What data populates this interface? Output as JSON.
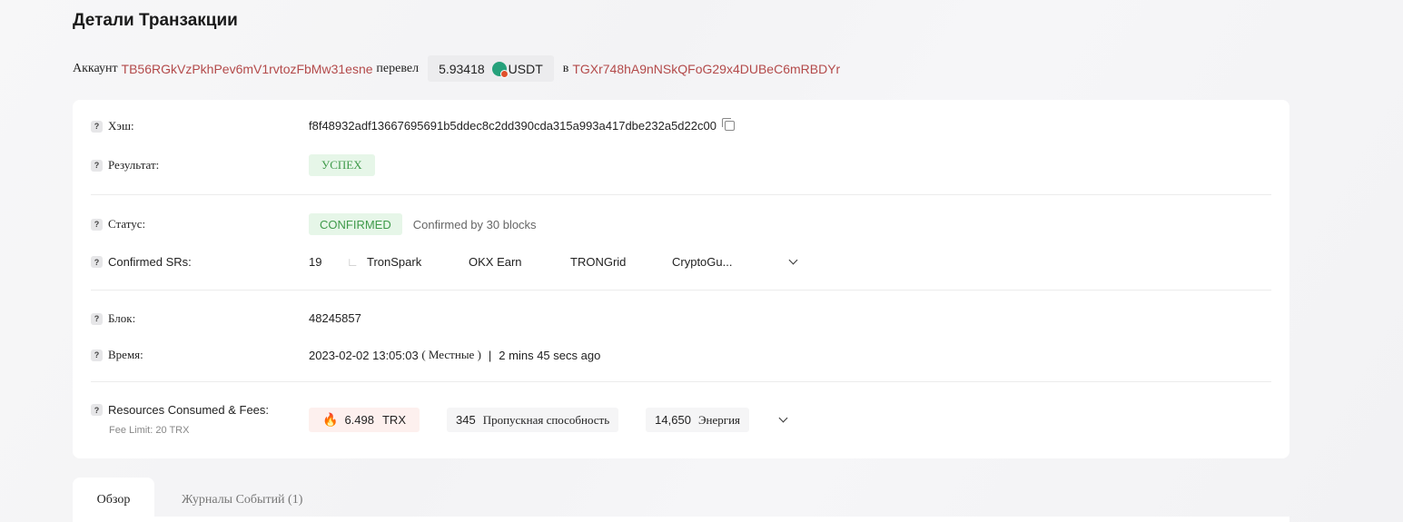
{
  "page": {
    "title": "Детали Транзакции"
  },
  "summary": {
    "account_label": "Аккаунт",
    "from_address": "TB56RGkVzPkhPev6mV1rvtozFbMw31esne",
    "sent_label": "перевел",
    "amount": "5.93418",
    "token": "USDT",
    "to_label": "в",
    "to_address": "TGXr748hA9nNSkQFoG29x4DUBeC6mRBDYr",
    "link_color": "#b34a4a"
  },
  "details": {
    "hash": {
      "label": "Хэш:",
      "value": "f8f48932adf13667695691b5ddec8c2dd390cda315a993a417dbe232a5d22c00"
    },
    "result": {
      "label": "Результат:",
      "value": "УСПЕХ"
    },
    "status": {
      "label": "Статус:",
      "value": "CONFIRMED",
      "note": "Confirmed by 30 blocks"
    },
    "confirmed_srs": {
      "label": "Confirmed SRs:",
      "count": "19",
      "items": [
        "TronSpark",
        "OKX Earn",
        "TRONGrid",
        "CryptoGu..."
      ]
    },
    "block": {
      "label": "Блок:",
      "value": "48245857"
    },
    "time": {
      "label": "Время:",
      "datetime": "2023-02-02 13:05:03",
      "zone": "( Местные )",
      "separator": "|",
      "relative": "2 mins 45 secs ago"
    },
    "resources": {
      "label": "Resources Consumed & Fees:",
      "fee_limit": "Fee Limit: 20 TRX",
      "trx_amount": "6.498",
      "trx_unit": "TRX",
      "bandwidth_amount": "345",
      "bandwidth_label": "Пропускная способность",
      "energy_amount": "14,650",
      "energy_label": "Энергия"
    }
  },
  "tabs": [
    {
      "label": "Обзор",
      "active": true
    },
    {
      "label": "Журналы Событий (1)",
      "active": false
    }
  ],
  "colors": {
    "success_bg": "#e6f6e8",
    "success_text": "#3f9a4a",
    "accent_red": "#b34a4a"
  },
  "icons": [
    "help-icon",
    "copy-icon",
    "token-usdt-icon",
    "flame-icon",
    "chevron-down-icon"
  ]
}
